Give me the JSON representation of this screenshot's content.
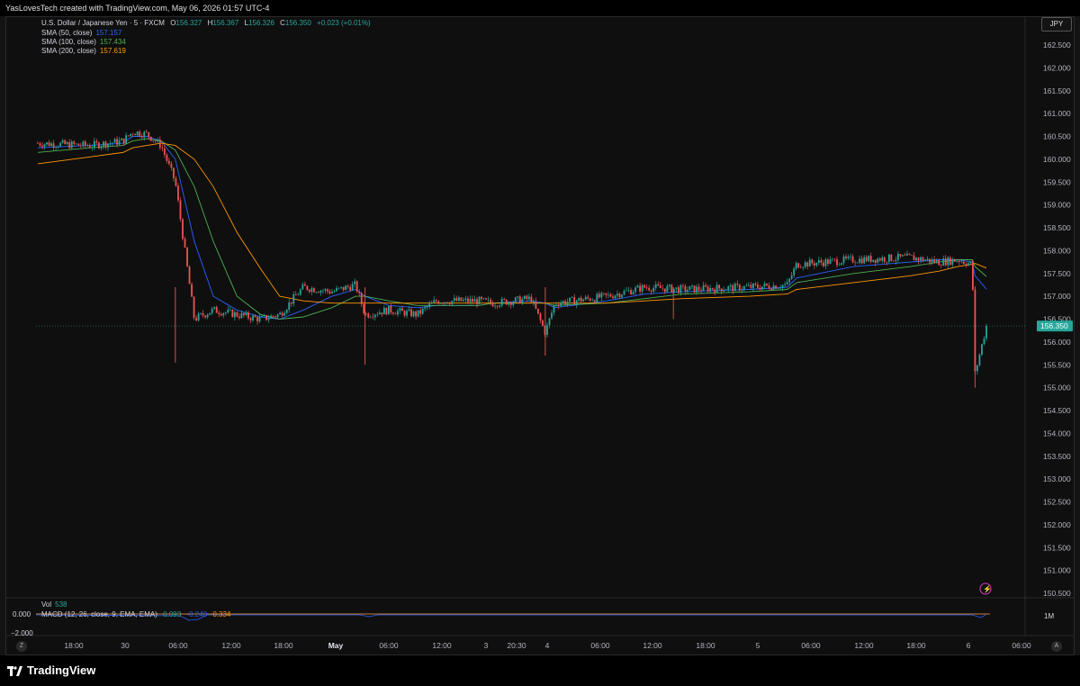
{
  "header": {
    "credit": "YasLovesTech created with TradingView.com, May 06, 2026 01:57 UTC-4"
  },
  "instrument": {
    "name": "U.S. Dollar / Japanese Yen · 5 · FXCM",
    "o_label": "O",
    "o": "156.327",
    "h_label": "H",
    "h": "156.367",
    "l_label": "L",
    "l": "156.326",
    "c_label": "C",
    "c": "156.350",
    "change": "+0.023 (+0.01%)"
  },
  "indicators": [
    {
      "label": "SMA (50, close)",
      "value": "157.157",
      "color": "#2962ff"
    },
    {
      "label": "SMA (100, close)",
      "value": "157.434",
      "color": "#4caf50"
    },
    {
      "label": "SMA (200, close)",
      "value": "157.619",
      "color": "#ff9800"
    }
  ],
  "currency_button": "JPY",
  "price_axis": [
    "162.500",
    "162.000",
    "161.500",
    "161.000",
    "160.500",
    "160.000",
    "159.500",
    "159.000",
    "158.500",
    "158.000",
    "157.500",
    "157.000",
    "156.500",
    "156.000",
    "155.500",
    "155.000",
    "154.500",
    "154.000",
    "153.500",
    "153.000",
    "152.500",
    "152.000",
    "151.500",
    "151.000",
    "150.500"
  ],
  "last_price_label": "156.350",
  "time_axis": [
    "18:00",
    "30",
    "06:00",
    "12:00",
    "18:00",
    "May",
    "06:00",
    "12:00",
    "3",
    "20:30",
    "4",
    "06:00",
    "12:00",
    "18:00",
    "5",
    "06:00",
    "12:00",
    "18:00",
    "6",
    "06:00"
  ],
  "volume": {
    "label": "Vol",
    "value": "538"
  },
  "macd": {
    "label": "MACD (12, 26, close, 9, EMA, EMA)",
    "v1": "0.093",
    "v2": "-0.240",
    "v3": "0.334"
  },
  "lower_axis": {
    "zero": "0.000",
    "neg": "−2.000",
    "right": "1M"
  },
  "nav": {
    "left": "Z",
    "right": "A"
  },
  "footer": {
    "brand": "TradingView"
  },
  "colors": {
    "up": "#26a69a",
    "down": "#ef5350",
    "sma50": "#2962ff",
    "sma100": "#4caf50",
    "sma200": "#ff9800",
    "last": "#26a69a"
  },
  "chart_data": {
    "type": "line",
    "title": "U.S. Dollar / Japanese Yen · 5 · FXCM",
    "xlabel": "",
    "ylabel": "",
    "ylim": [
      150.5,
      162.5
    ],
    "x": [
      "Apr 29 12:00",
      "Apr 29 18:00",
      "Apr 30 00:00",
      "Apr 30 03:00",
      "Apr 30 04:00",
      "Apr 30 05:00",
      "Apr 30 06:00",
      "Apr 30 07:00",
      "Apr 30 09:00",
      "Apr 30 12:00",
      "Apr 30 15:00",
      "Apr 30 18:00",
      "Apr 30 21:00",
      "May 1 00:00",
      "May 1 02:00",
      "May 1 03:00",
      "May 1 06:00",
      "May 1 09:00",
      "May 1 12:00",
      "May 1 18:00",
      "May 3 20:30",
      "May 4 00:00",
      "May 4 03:00",
      "May 4 06:00",
      "May 4 12:00",
      "May 4 15:00",
      "May 4 18:00",
      "May 5 00:00",
      "May 5 03:00",
      "May 5 06:00",
      "May 5 12:00",
      "May 5 18:00",
      "May 5 21:00",
      "May 6 00:00",
      "May 6 00:30",
      "May 6 01:00",
      "May 6 01:55"
    ],
    "series": [
      {
        "name": "USDJPY close",
        "values": [
          160.35,
          160.3,
          160.4,
          160.6,
          160.55,
          160.3,
          159.5,
          156.5,
          156.7,
          156.6,
          156.5,
          156.6,
          157.2,
          157.1,
          157.25,
          156.6,
          156.7,
          156.6,
          156.9,
          156.9,
          156.85,
          156.95,
          156.2,
          156.85,
          157.0,
          157.2,
          157.15,
          157.2,
          157.25,
          157.7,
          157.8,
          157.85,
          157.75,
          157.8,
          157.7,
          155.3,
          156.35
        ]
      },
      {
        "name": "SMA (50, close)",
        "values": [
          160.25,
          160.3,
          160.35,
          160.5,
          160.5,
          160.4,
          160.0,
          158.2,
          157.0,
          156.7,
          156.55,
          156.5,
          156.7,
          157.0,
          157.15,
          157.0,
          156.8,
          156.75,
          156.8,
          156.8,
          156.85,
          156.9,
          156.85,
          156.75,
          156.9,
          157.05,
          157.1,
          157.15,
          157.2,
          157.4,
          157.65,
          157.75,
          157.8,
          157.8,
          157.75,
          157.45,
          157.157
        ]
      },
      {
        "name": "SMA (100, close)",
        "values": [
          160.15,
          160.25,
          160.3,
          160.4,
          160.45,
          160.4,
          160.2,
          159.4,
          158.2,
          157.0,
          156.6,
          156.5,
          156.55,
          156.75,
          157.0,
          157.0,
          156.9,
          156.8,
          156.8,
          156.8,
          156.85,
          156.85,
          156.85,
          156.8,
          156.85,
          156.95,
          157.05,
          157.1,
          157.15,
          157.3,
          157.5,
          157.65,
          157.75,
          157.8,
          157.8,
          157.65,
          157.434
        ]
      },
      {
        "name": "SMA (200, close)",
        "values": [
          159.9,
          160.05,
          160.15,
          160.25,
          160.3,
          160.35,
          160.3,
          160.0,
          159.4,
          158.4,
          157.6,
          157.0,
          156.9,
          156.85,
          156.85,
          156.85,
          156.85,
          156.85,
          156.85,
          156.85,
          156.85,
          156.85,
          156.85,
          156.85,
          156.85,
          156.9,
          156.95,
          157.0,
          157.05,
          157.15,
          157.3,
          157.45,
          157.55,
          157.65,
          157.7,
          157.72,
          157.619
        ]
      }
    ],
    "last_price": 156.35,
    "grid": false,
    "legend": "top-left"
  }
}
